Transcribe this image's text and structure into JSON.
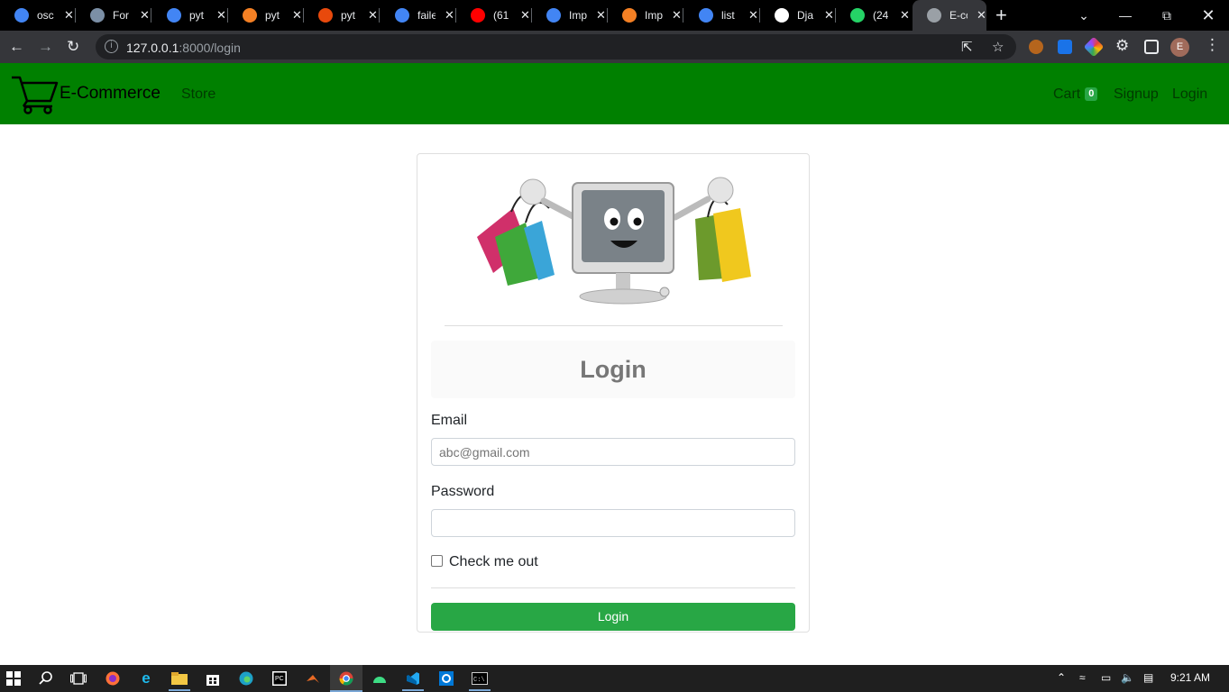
{
  "browser": {
    "tabs": [
      {
        "title": "osc",
        "icon": "google-icon",
        "color": "#4285f4"
      },
      {
        "title": "For",
        "icon": "building-icon",
        "color": "#7b8fa6"
      },
      {
        "title": "pyt",
        "icon": "google-icon",
        "color": "#4285f4"
      },
      {
        "title": "pyt",
        "icon": "stackoverflow-icon",
        "color": "#f48024"
      },
      {
        "title": "pyt",
        "icon": "ask-icon",
        "color": "#e8490c"
      },
      {
        "title": "faile",
        "icon": "google-icon",
        "color": "#4285f4"
      },
      {
        "title": "(61",
        "icon": "youtube-icon",
        "color": "#ff0000"
      },
      {
        "title": "Imp",
        "icon": "google-icon",
        "color": "#4285f4"
      },
      {
        "title": "Imp",
        "icon": "stackoverflow-icon",
        "color": "#f48024"
      },
      {
        "title": "list",
        "icon": "google-icon",
        "color": "#4285f4"
      },
      {
        "title": "Dja",
        "icon": "windows-icon",
        "color": "#ffffff"
      },
      {
        "title": "(24",
        "icon": "whatsapp-icon",
        "color": "#25d366"
      },
      {
        "title": "E-co",
        "icon": "globe-icon",
        "color": "#9aa0a6"
      }
    ],
    "url_host": "127.0.0.1",
    "url_rest": ":8000/login",
    "profile_initial": "E"
  },
  "navbar": {
    "brand": "E-Commerce",
    "store": "Store",
    "cart": "Cart",
    "cart_count": "0",
    "signup": "Signup",
    "login": "Login"
  },
  "login": {
    "title": "Login",
    "email_label": "Email",
    "email_placeholder": "abc@gmail.com",
    "password_label": "Password",
    "password_placeholder": "",
    "checkbox_label": "Check me out",
    "button": "Login"
  },
  "taskbar": {
    "time": "9:21 AM"
  },
  "colors": {
    "navbar": "#008000",
    "button": "#28a745",
    "badge": "#28a745"
  }
}
